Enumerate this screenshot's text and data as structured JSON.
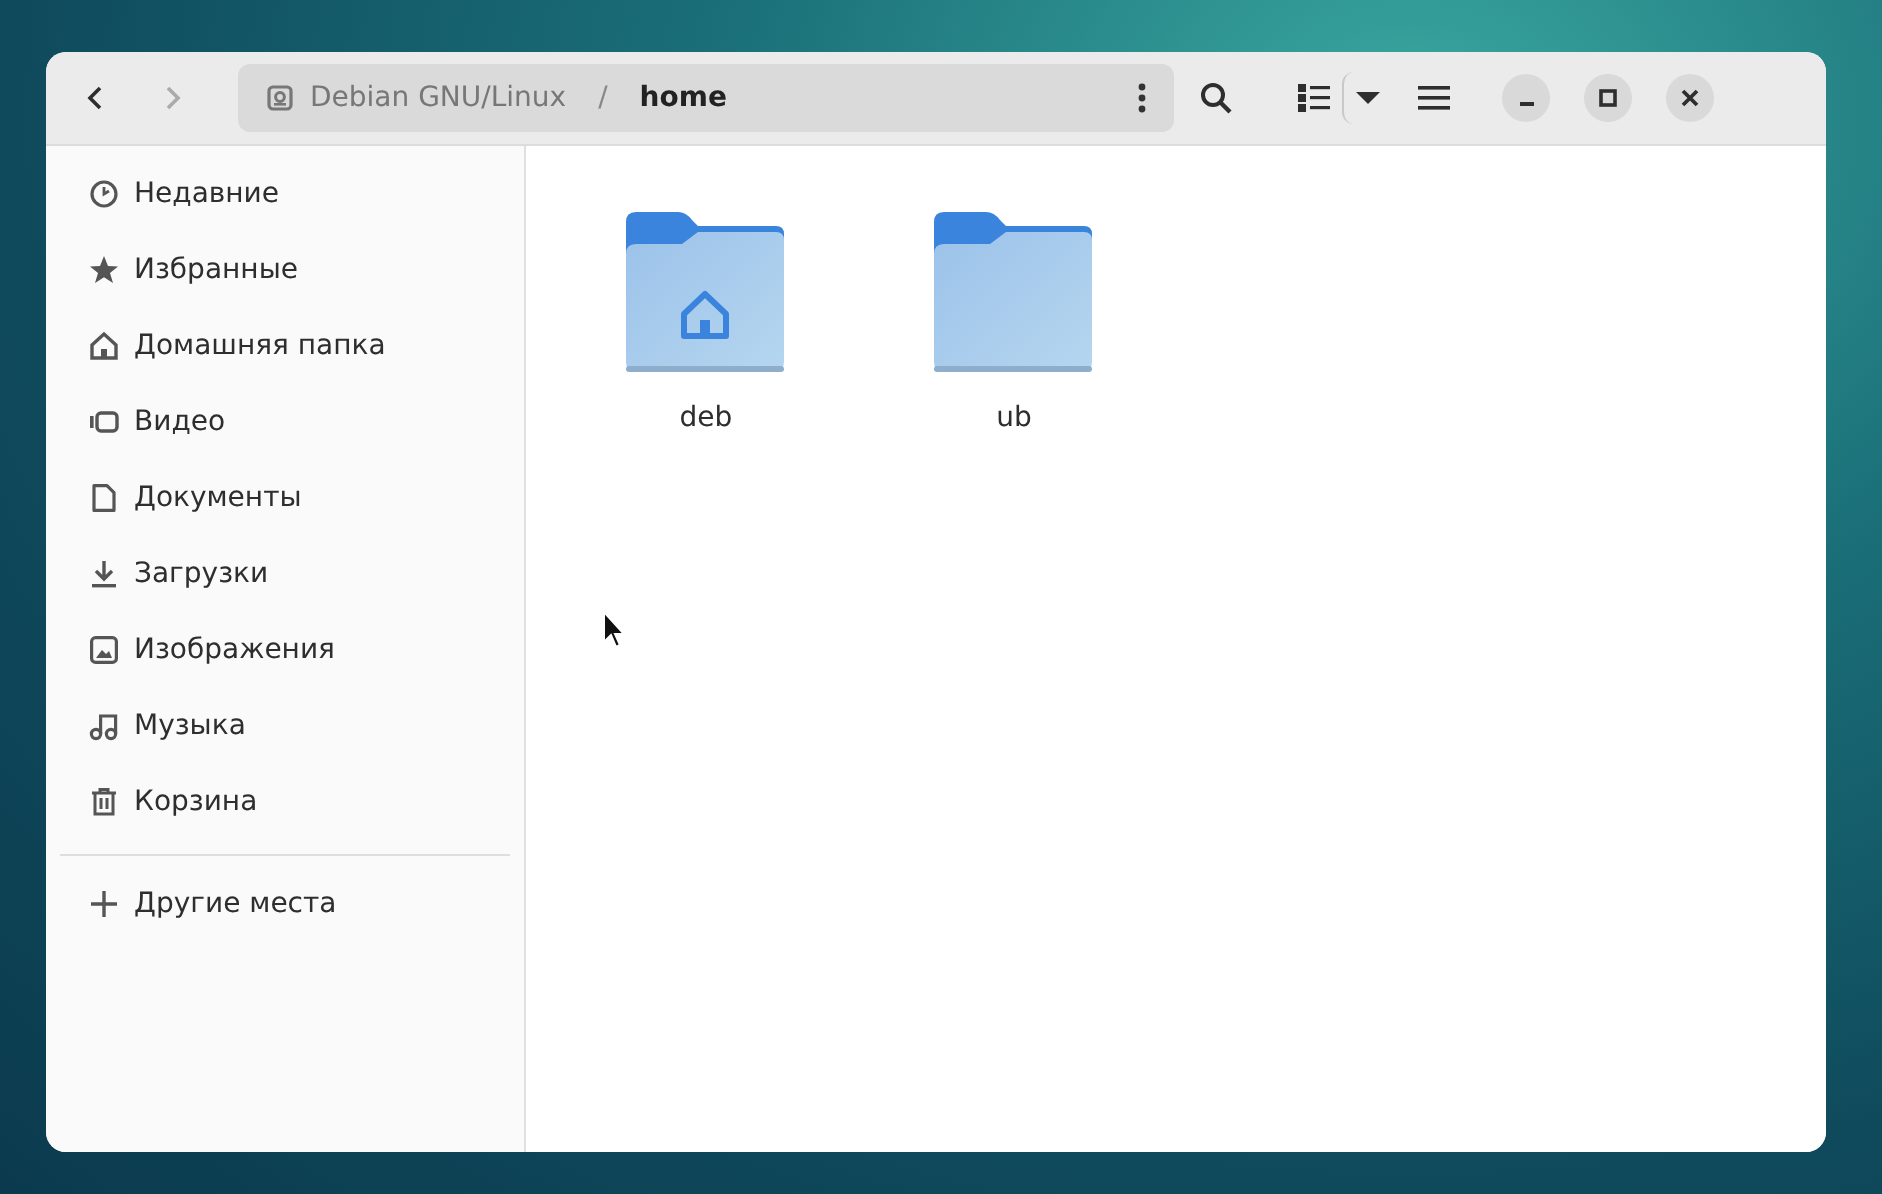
{
  "path_bar": {
    "device": "Debian GNU/Linux",
    "separator": "/",
    "current": "home"
  },
  "nav": {
    "back_disabled": false,
    "forward_disabled": true
  },
  "sidebar": {
    "items": [
      {
        "label": "Недавние",
        "kind": "recent",
        "selected": false
      },
      {
        "label": "Избранные",
        "kind": "starred",
        "selected": false
      },
      {
        "label": "Домашняя папка",
        "kind": "home",
        "selected": false
      },
      {
        "label": "Видео",
        "kind": "video",
        "selected": false
      },
      {
        "label": "Документы",
        "kind": "documents",
        "selected": false
      },
      {
        "label": "Загрузки",
        "kind": "downloads",
        "selected": false
      },
      {
        "label": "Изображения",
        "kind": "pictures",
        "selected": false
      },
      {
        "label": "Музыка",
        "kind": "music",
        "selected": false
      },
      {
        "label": "Корзина",
        "kind": "trash",
        "selected": false
      }
    ],
    "other": {
      "label": "Другие места",
      "kind": "add"
    }
  },
  "files": [
    {
      "name": "deb",
      "kind": "home-folder",
      "selected": false
    },
    {
      "name": "ub",
      "kind": "folder",
      "selected": false
    }
  ]
}
